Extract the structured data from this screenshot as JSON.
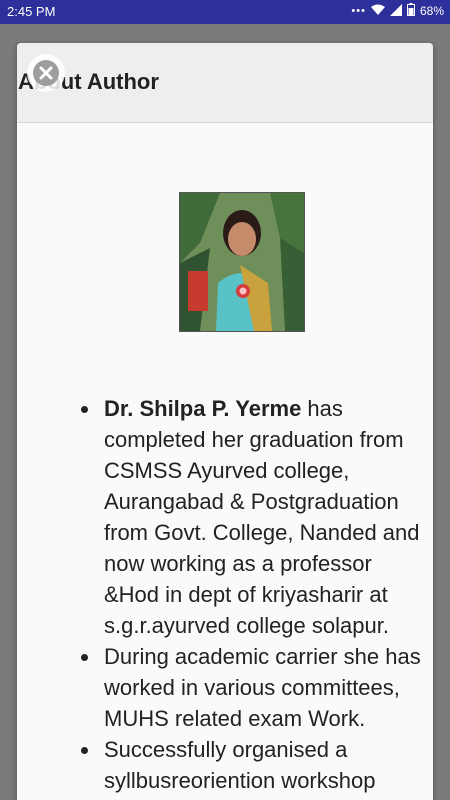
{
  "status_bar": {
    "time": "2:45 PM",
    "battery": "68%",
    "icons": [
      "notification-dots-icon",
      "wifi-icon",
      "signal-icon",
      "battery-icon"
    ]
  },
  "dialog": {
    "title": "About Author",
    "close_icon": "close-circle-icon",
    "photo_alt": "author-photo",
    "bio_items": [
      {
        "name": "Dr. Shilpa P. Yerme",
        "text": " has completed her graduation from CSMSS Ayurved college, Aurangabad & Postgraduation  from Govt. College, Nanded and now working as a professor &Hod in dept of kriyasharir at s.g.r.ayurved college solapur."
      },
      {
        "text": "During academic carrier she has worked in various committees, MUHS related exam Work."
      },
      {
        "text": "Successfully organised a syllbusreoriention workshop"
      }
    ]
  },
  "colors": {
    "status_bar": "#2d2f9a",
    "backdrop": "#7a7a7a",
    "dialog_bg": "#fafafa",
    "header_bg": "#eeeeee",
    "text": "#222222"
  }
}
